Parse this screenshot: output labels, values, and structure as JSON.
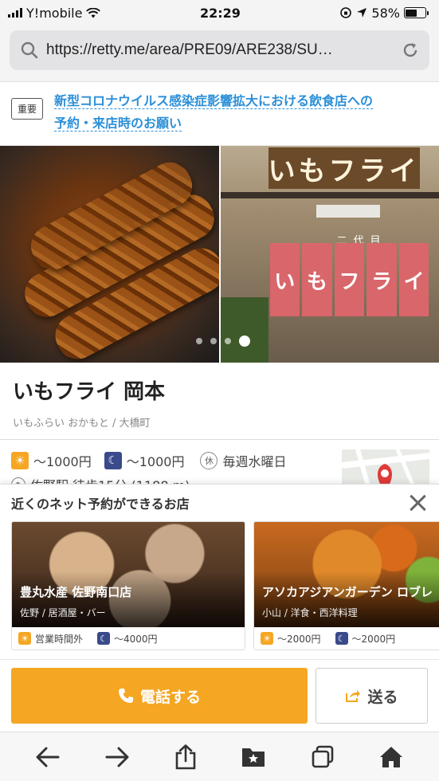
{
  "status_bar": {
    "carrier": "Y!mobile",
    "time": "22:29",
    "battery": "58%",
    "battery_level": 0.58
  },
  "browser": {
    "url": "https://retty.me/area/PRE09/ARE238/SU…"
  },
  "notice": {
    "badge": "重要",
    "line1": "新型コロナウイルス感染症影響拡大における飲食店への",
    "line2": "予約・来店時のお願い"
  },
  "photos": {
    "shop_sign": "いもフライ",
    "noren_top": "二代目",
    "noren": [
      "い",
      "も",
      "フ",
      "ラ",
      "イ"
    ]
  },
  "restaurant": {
    "name": "いもフライ 岡本",
    "kana": "いもふらい おかもと / 大橋町",
    "lunch_price": "〜1000円",
    "dinner_price": "〜1000円",
    "rest_icon": "休",
    "holiday": "毎週水曜日",
    "access": "佐野駅 徒歩15分 (1188 m)"
  },
  "nearby": {
    "title": "近くのネット予約ができるお店",
    "cards": [
      {
        "name": "豊丸水産 佐野南口店",
        "genre": "佐野 / 居酒屋・バー",
        "lunch": "営業時間外",
        "dinner": "〜4000円"
      },
      {
        "name": "アソカアジアンガーデン ロブレ",
        "genre": "小山 / 洋食・西洋料理",
        "lunch": "〜2000円",
        "dinner": "〜2000円"
      }
    ]
  },
  "actions": {
    "call": "電話する",
    "send": "送る"
  },
  "colors": {
    "accent": "#f5a623",
    "link": "#2b8fd8",
    "night": "#3a4a8a"
  },
  "icons": [
    "search-icon",
    "reload-icon",
    "sun-icon",
    "moon-icon",
    "map-pin-icon",
    "phone-icon",
    "share-icon",
    "back-icon",
    "forward-icon",
    "share-up-icon",
    "bookmarks-icon",
    "tabs-icon",
    "home-icon"
  ]
}
